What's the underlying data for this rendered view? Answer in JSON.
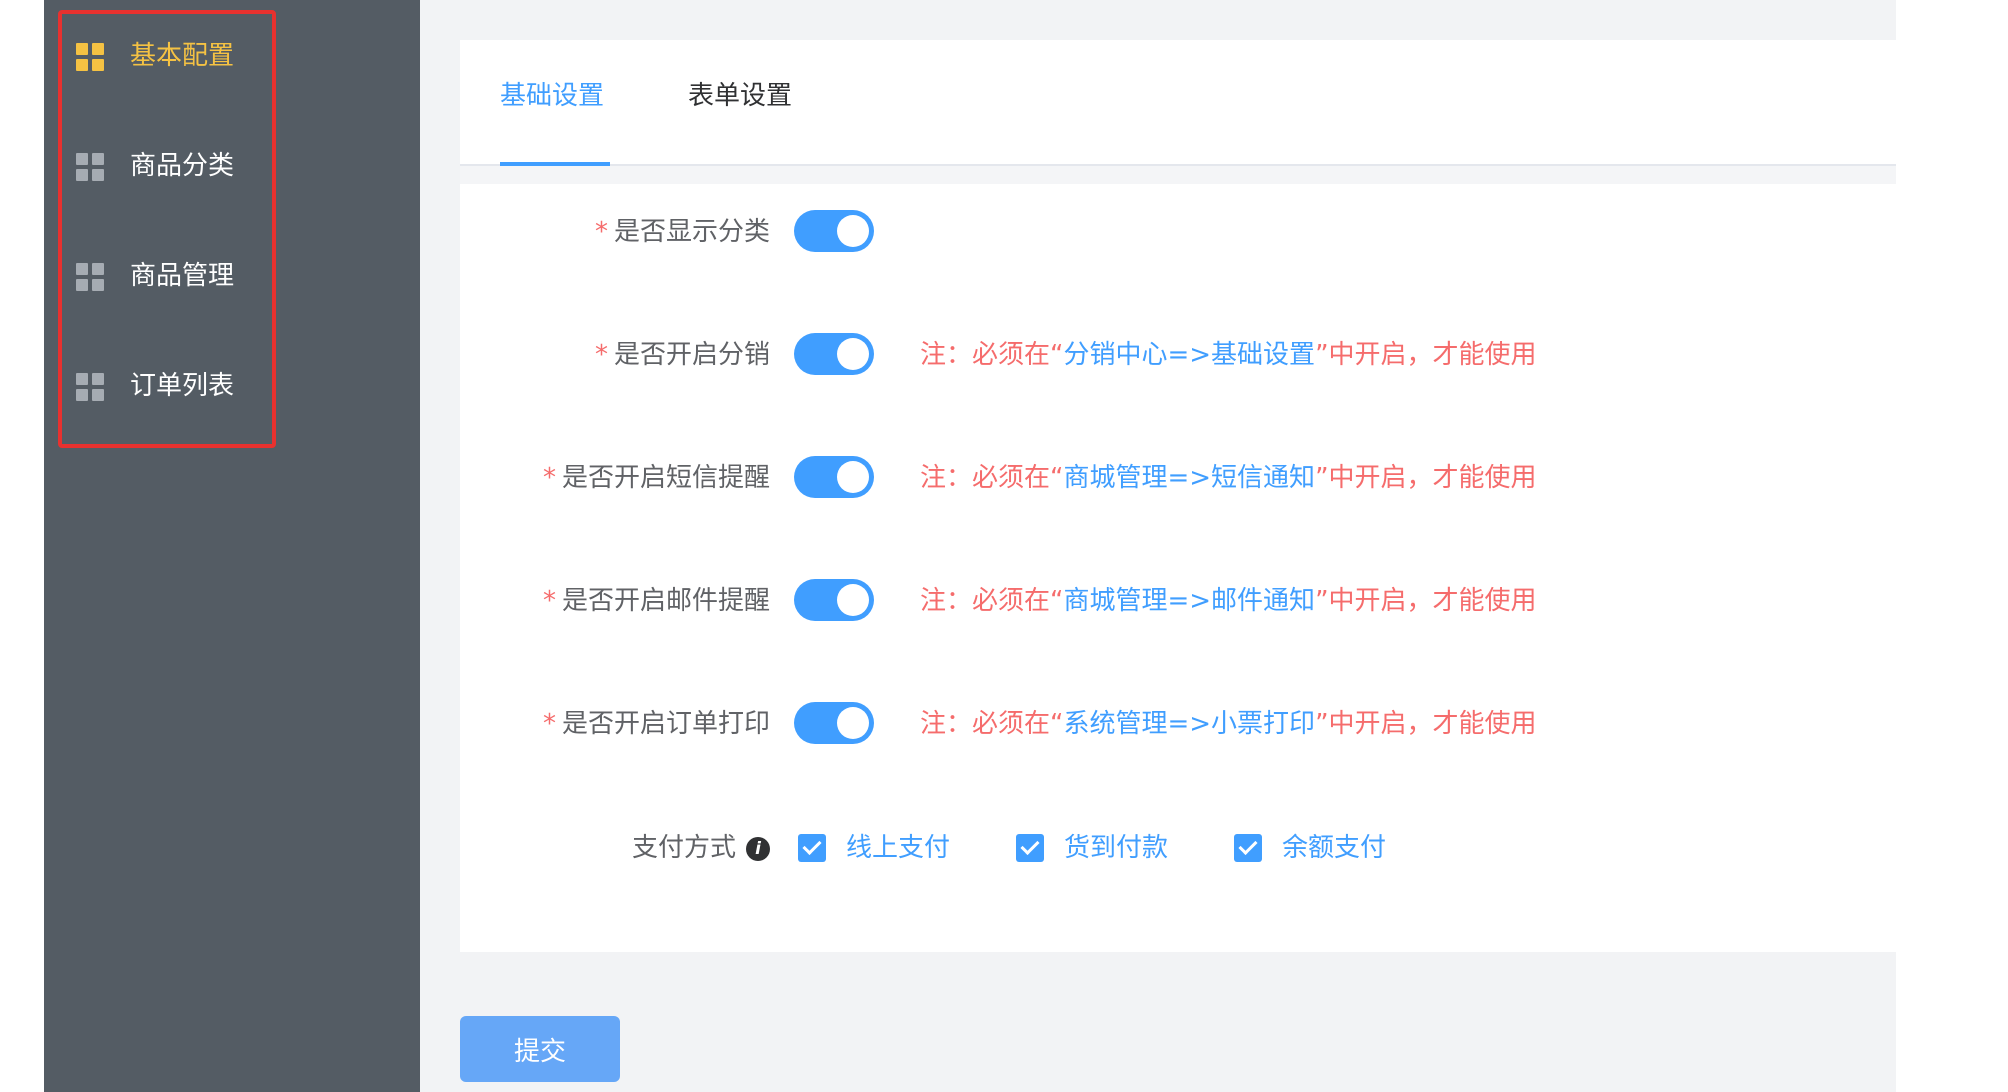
{
  "sidebar": {
    "items": [
      {
        "label": "基本配置",
        "icon": "grid-icon",
        "active": true
      },
      {
        "label": "商品分类",
        "icon": "grid-icon",
        "active": false
      },
      {
        "label": "商品管理",
        "icon": "grid-icon",
        "active": false
      },
      {
        "label": "订单列表",
        "icon": "grid-icon",
        "active": false
      }
    ]
  },
  "tabs": [
    {
      "label": "基础设置",
      "active": true
    },
    {
      "label": "表单设置",
      "active": false
    }
  ],
  "form": {
    "rows": [
      {
        "label": "是否显示分类",
        "required": true,
        "enabled": true,
        "note_prefix": "",
        "note_path": "",
        "note_suffix": ""
      },
      {
        "label": "是否开启分销",
        "required": true,
        "enabled": true,
        "note_prefix": "注：必须在“",
        "note_path": "分销中心=>基础设置",
        "note_suffix": "”中开启，才能使用"
      },
      {
        "label": "是否开启短信提醒",
        "required": true,
        "enabled": true,
        "note_prefix": "注：必须在“",
        "note_path": "商城管理=>短信通知",
        "note_suffix": "”中开启，才能使用"
      },
      {
        "label": "是否开启邮件提醒",
        "required": true,
        "enabled": true,
        "note_prefix": "注：必须在“",
        "note_path": "商城管理=>邮件通知",
        "note_suffix": "”中开启，才能使用"
      },
      {
        "label": "是否开启订单打印",
        "required": true,
        "enabled": true,
        "note_prefix": "注：必须在“",
        "note_path": "系统管理=>小票打印",
        "note_suffix": "”中开启，才能使用"
      }
    ],
    "payment": {
      "label": "支付方式",
      "info_glyph": "i",
      "options": [
        {
          "label": "线上支付",
          "checked": true
        },
        {
          "label": "货到付款",
          "checked": true
        },
        {
          "label": "余额支付",
          "checked": true
        }
      ]
    },
    "required_mark": "*"
  },
  "submit_label": "提交",
  "colors": {
    "sidebar_bg": "#545c64",
    "active_nav": "#f5c243",
    "primary": "#409eff",
    "danger": "#f56c6c",
    "highlight_border": "#e8312f"
  }
}
